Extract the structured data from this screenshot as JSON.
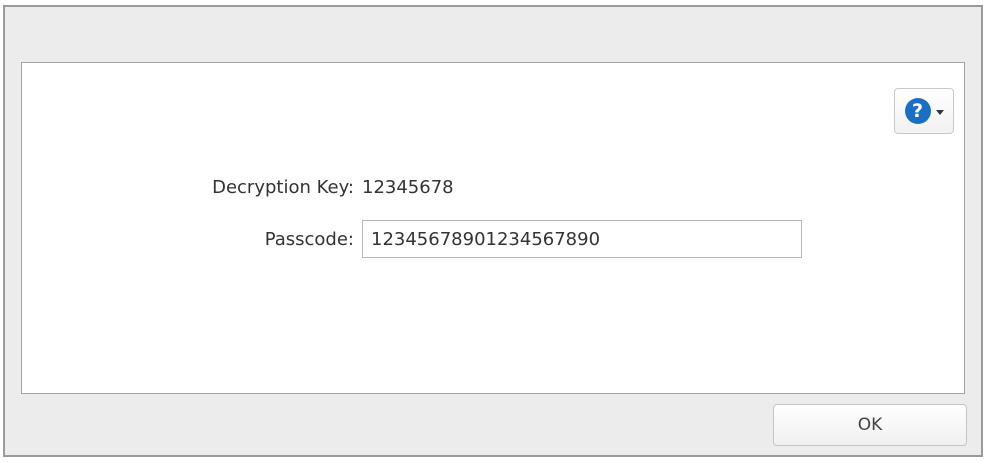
{
  "dialog": {
    "help_icon": "question-circle-icon",
    "help_glyph": "?",
    "fields": {
      "decryption_key_label": "Decryption Key:",
      "decryption_key_value": "12345678",
      "passcode_label": "Passcode:",
      "passcode_value": "12345678901234567890"
    },
    "ok_label": "OK"
  },
  "colors": {
    "help_icon": "#1a6fc4",
    "dialog_bg": "#ececec",
    "content_bg": "#ffffff"
  }
}
